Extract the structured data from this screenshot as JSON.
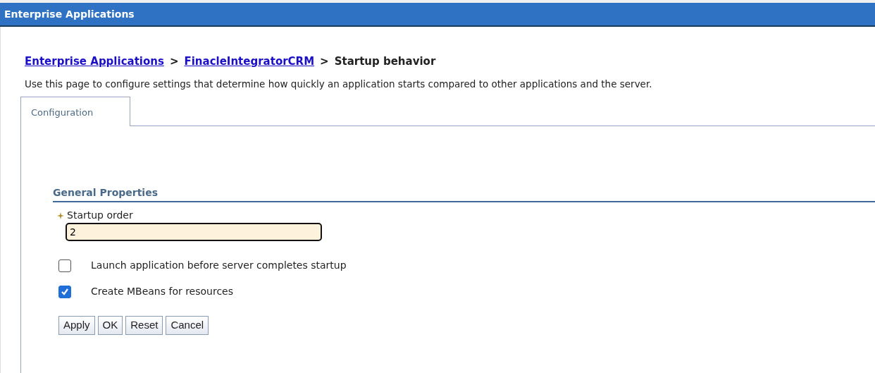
{
  "window": {
    "title": "Enterprise Applications"
  },
  "breadcrumb": [
    {
      "label": "Enterprise Applications",
      "kind": "link"
    },
    {
      "label": ">",
      "kind": "separator"
    },
    {
      "label": "FinacleIntegratorCRM",
      "kind": "link"
    },
    {
      "label": ">",
      "kind": "separator"
    },
    {
      "label": "Startup behavior",
      "kind": "current"
    }
  ],
  "description": "Use this page to configure settings that determine how quickly an application starts compared to other applications and the server.",
  "tabs": [
    {
      "label": "Configuration",
      "selected": true
    }
  ],
  "section": {
    "title": "General Properties"
  },
  "field": {
    "label": "Startup order",
    "required": true,
    "value": "2"
  },
  "checkboxes": [
    {
      "label": "Launch application before server completes startup",
      "checked": false
    },
    {
      "label": "Create MBeans for resources",
      "checked": true
    }
  ],
  "buttons": [
    "Apply",
    "OK",
    "Reset",
    "Cancel"
  ]
}
